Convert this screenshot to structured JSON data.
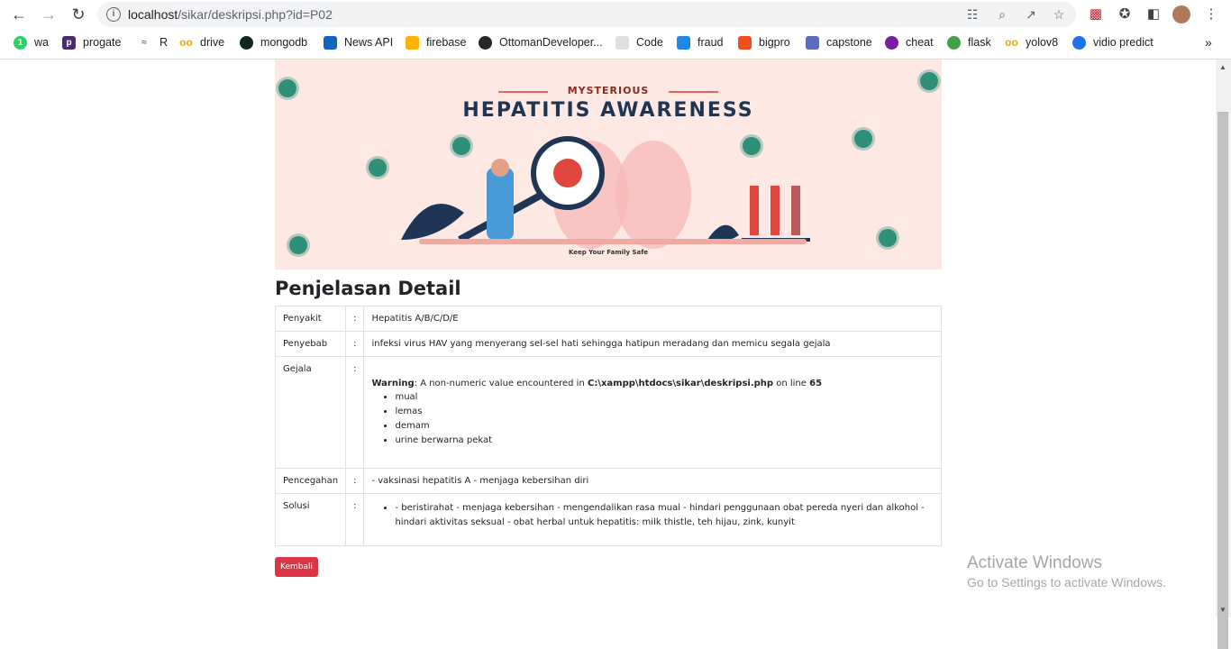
{
  "browser": {
    "url_host": "localhost",
    "url_path": "/sikar/deskripsi.php?id=P02",
    "bookmarks": [
      {
        "label": "wa",
        "color": "#25d366",
        "icon": "wa-icon"
      },
      {
        "label": "progate",
        "color": "#4b2b6d",
        "icon": "progate-icon"
      },
      {
        "label": "R",
        "color": "#3c8d4f",
        "icon": "r-icon"
      },
      {
        "label": "drive",
        "color": "#f4a300",
        "icon": "colab-icon"
      },
      {
        "label": "mongodb",
        "color": "#13261a",
        "icon": "mongodb-icon"
      },
      {
        "label": "News API",
        "color": "#1565c0",
        "icon": "newsapi-icon"
      },
      {
        "label": "firebase",
        "color": "#ffb300",
        "icon": "firebase-icon"
      },
      {
        "label": "OttomanDeveloper...",
        "color": "#24292e",
        "icon": "github-icon"
      },
      {
        "label": "Code",
        "color": "#d0d0d0",
        "icon": "code-icon"
      },
      {
        "label": "fraud",
        "color": "#1e88e5",
        "icon": "fraud-icon"
      },
      {
        "label": "bigpro",
        "color": "#f24e1e",
        "icon": "figma-icon"
      },
      {
        "label": "capstone",
        "color": "#5c6bc0",
        "icon": "capstone-icon"
      },
      {
        "label": "cheat",
        "color": "#7b1fa2",
        "icon": "cheat-icon"
      },
      {
        "label": "flask",
        "color": "#43a047",
        "icon": "flask-icon"
      },
      {
        "label": "yolov8",
        "color": "#f4a300",
        "icon": "colab-icon"
      },
      {
        "label": "vidio predict",
        "color": "#1a73e8",
        "icon": "vidio-icon"
      }
    ]
  },
  "banner": {
    "subtitle": "MYSTERIOUS",
    "title": "HEPATITIS AWARENESS",
    "footer": "Keep Your Family Safe"
  },
  "page": {
    "heading": "Penjelasan Detail",
    "colon": ":",
    "rows": {
      "penyakit": {
        "label": "Penyakit",
        "value": "Hepatitis A/B/C/D/E"
      },
      "penyebab": {
        "label": "Penyebab",
        "value": "infeksi virus HAV yang menyerang sel-sel hati sehingga hatipun meradang dan memicu segala gejala"
      },
      "gejala": {
        "label": "Gejala",
        "warning_label": "Warning",
        "warning_text_1": ": A non-numeric value encountered in ",
        "warning_path": "C:\\xampp\\htdocs\\sikar\\deskripsi.php",
        "warning_text_2": " on line ",
        "warning_line": "65",
        "items": [
          "mual",
          "lemas",
          "demam",
          "urine berwarna pekat"
        ]
      },
      "pencegahan": {
        "label": "Pencegahan",
        "value": "- vaksinasi hepatitis A - menjaga kebersihan diri"
      },
      "solusi": {
        "label": "Solusi",
        "value": "- beristirahat - menjaga kebersihan - mengendalikan rasa mual - hindari penggunaan obat pereda nyeri dan alkohol - hindari aktivitas seksual - obat herbal untuk hepatitis: milk thistle, teh hijau, zink, kunyit"
      }
    },
    "back_button": "Kembali"
  },
  "watermark": {
    "line1": "Activate Windows",
    "line2": "Go to Settings to activate Windows."
  }
}
